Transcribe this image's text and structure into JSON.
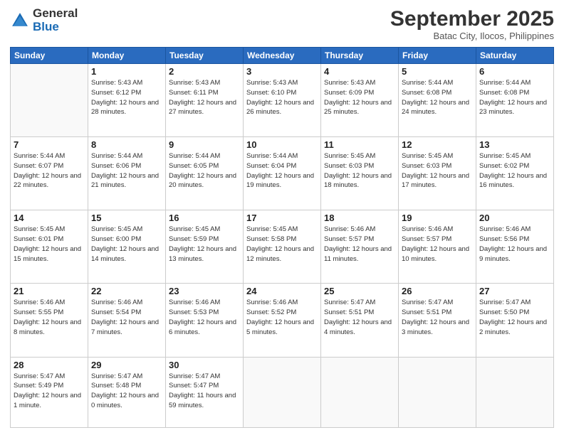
{
  "logo": {
    "general": "General",
    "blue": "Blue"
  },
  "header": {
    "month": "September 2025",
    "location": "Batac City, Ilocos, Philippines"
  },
  "weekdays": [
    "Sunday",
    "Monday",
    "Tuesday",
    "Wednesday",
    "Thursday",
    "Friday",
    "Saturday"
  ],
  "weeks": [
    [
      {
        "day": "",
        "empty": true
      },
      {
        "day": "1",
        "sunrise": "5:43 AM",
        "sunset": "6:12 PM",
        "daylight": "12 hours and 28 minutes."
      },
      {
        "day": "2",
        "sunrise": "5:43 AM",
        "sunset": "6:11 PM",
        "daylight": "12 hours and 27 minutes."
      },
      {
        "day": "3",
        "sunrise": "5:43 AM",
        "sunset": "6:10 PM",
        "daylight": "12 hours and 26 minutes."
      },
      {
        "day": "4",
        "sunrise": "5:43 AM",
        "sunset": "6:09 PM",
        "daylight": "12 hours and 25 minutes."
      },
      {
        "day": "5",
        "sunrise": "5:44 AM",
        "sunset": "6:08 PM",
        "daylight": "12 hours and 24 minutes."
      },
      {
        "day": "6",
        "sunrise": "5:44 AM",
        "sunset": "6:08 PM",
        "daylight": "12 hours and 23 minutes."
      }
    ],
    [
      {
        "day": "7",
        "sunrise": "5:44 AM",
        "sunset": "6:07 PM",
        "daylight": "12 hours and 22 minutes."
      },
      {
        "day": "8",
        "sunrise": "5:44 AM",
        "sunset": "6:06 PM",
        "daylight": "12 hours and 21 minutes."
      },
      {
        "day": "9",
        "sunrise": "5:44 AM",
        "sunset": "6:05 PM",
        "daylight": "12 hours and 20 minutes."
      },
      {
        "day": "10",
        "sunrise": "5:44 AM",
        "sunset": "6:04 PM",
        "daylight": "12 hours and 19 minutes."
      },
      {
        "day": "11",
        "sunrise": "5:45 AM",
        "sunset": "6:03 PM",
        "daylight": "12 hours and 18 minutes."
      },
      {
        "day": "12",
        "sunrise": "5:45 AM",
        "sunset": "6:03 PM",
        "daylight": "12 hours and 17 minutes."
      },
      {
        "day": "13",
        "sunrise": "5:45 AM",
        "sunset": "6:02 PM",
        "daylight": "12 hours and 16 minutes."
      }
    ],
    [
      {
        "day": "14",
        "sunrise": "5:45 AM",
        "sunset": "6:01 PM",
        "daylight": "12 hours and 15 minutes."
      },
      {
        "day": "15",
        "sunrise": "5:45 AM",
        "sunset": "6:00 PM",
        "daylight": "12 hours and 14 minutes."
      },
      {
        "day": "16",
        "sunrise": "5:45 AM",
        "sunset": "5:59 PM",
        "daylight": "12 hours and 13 minutes."
      },
      {
        "day": "17",
        "sunrise": "5:45 AM",
        "sunset": "5:58 PM",
        "daylight": "12 hours and 12 minutes."
      },
      {
        "day": "18",
        "sunrise": "5:46 AM",
        "sunset": "5:57 PM",
        "daylight": "12 hours and 11 minutes."
      },
      {
        "day": "19",
        "sunrise": "5:46 AM",
        "sunset": "5:57 PM",
        "daylight": "12 hours and 10 minutes."
      },
      {
        "day": "20",
        "sunrise": "5:46 AM",
        "sunset": "5:56 PM",
        "daylight": "12 hours and 9 minutes."
      }
    ],
    [
      {
        "day": "21",
        "sunrise": "5:46 AM",
        "sunset": "5:55 PM",
        "daylight": "12 hours and 8 minutes."
      },
      {
        "day": "22",
        "sunrise": "5:46 AM",
        "sunset": "5:54 PM",
        "daylight": "12 hours and 7 minutes."
      },
      {
        "day": "23",
        "sunrise": "5:46 AM",
        "sunset": "5:53 PM",
        "daylight": "12 hours and 6 minutes."
      },
      {
        "day": "24",
        "sunrise": "5:46 AM",
        "sunset": "5:52 PM",
        "daylight": "12 hours and 5 minutes."
      },
      {
        "day": "25",
        "sunrise": "5:47 AM",
        "sunset": "5:51 PM",
        "daylight": "12 hours and 4 minutes."
      },
      {
        "day": "26",
        "sunrise": "5:47 AM",
        "sunset": "5:51 PM",
        "daylight": "12 hours and 3 minutes."
      },
      {
        "day": "27",
        "sunrise": "5:47 AM",
        "sunset": "5:50 PM",
        "daylight": "12 hours and 2 minutes."
      }
    ],
    [
      {
        "day": "28",
        "sunrise": "5:47 AM",
        "sunset": "5:49 PM",
        "daylight": "12 hours and 1 minute."
      },
      {
        "day": "29",
        "sunrise": "5:47 AM",
        "sunset": "5:48 PM",
        "daylight": "12 hours and 0 minutes."
      },
      {
        "day": "30",
        "sunrise": "5:47 AM",
        "sunset": "5:47 PM",
        "daylight": "11 hours and 59 minutes."
      },
      {
        "day": "",
        "empty": true
      },
      {
        "day": "",
        "empty": true
      },
      {
        "day": "",
        "empty": true
      },
      {
        "day": "",
        "empty": true
      }
    ]
  ]
}
